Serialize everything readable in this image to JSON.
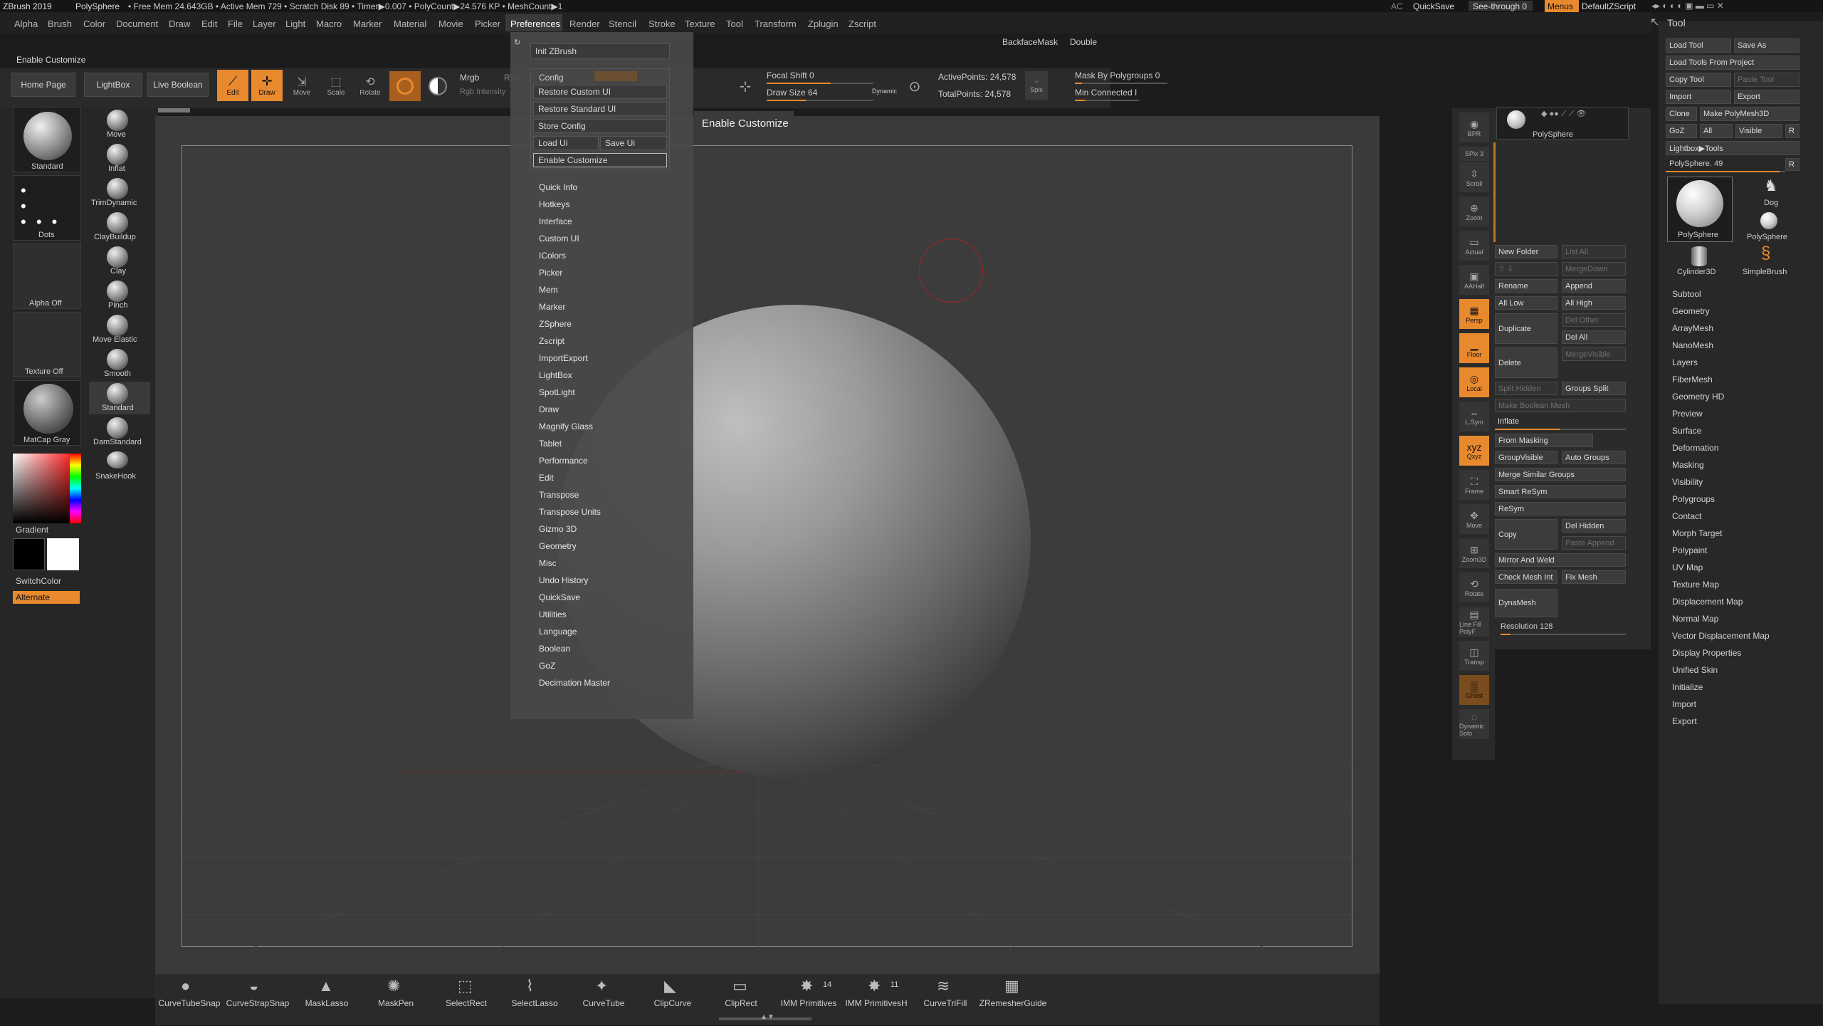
{
  "topbar": {
    "app": "ZBrush 2019",
    "project": "PolySphere",
    "status": "• Free Mem 24.643GB • Active Mem 729 • Scratch Disk 89 • Timer▶0.007 • PolyCount▶24.576 KP • MeshCount▶1",
    "ac": "AC",
    "quicksave": "QuickSave",
    "seethrough": "See-through  0",
    "menus": "Menus",
    "zscript": "DefaultZScript"
  },
  "menubar": [
    "Alpha",
    "Brush",
    "Color",
    "Document",
    "Draw",
    "Edit",
    "File",
    "Layer",
    "Light",
    "Macro",
    "Marker",
    "Material",
    "Movie",
    "Picker",
    "Preferences",
    "Render",
    "Stencil",
    "Stroke",
    "Texture",
    "Tool",
    "Transform",
    "Zplugin",
    "Zscript"
  ],
  "enable_customize_label": "Enable Customize",
  "shelf": {
    "home": "Home Page",
    "lightbox": "LightBox",
    "liveboolean": "Live Boolean",
    "edit": "Edit",
    "draw": "Draw",
    "move": "Move",
    "scale": "Scale",
    "rotate": "Rotate",
    "mrgb": "Mrgb",
    "rgb": "Rgb",
    "rgbint": "Rgb Intensity",
    "focal": "Focal Shift 0",
    "drawsize": "Draw Size 64",
    "dynamic": "Dynamic",
    "active": "ActivePoints: 24,578",
    "total": "TotalPoints: 24,578",
    "spix": "Spix",
    "mask": "Mask By Polygroups 0",
    "minconn": "Min Connected I",
    "backface": "BackfaceMask",
    "double": "Double"
  },
  "left": {
    "brushes": [
      "Standard",
      "Dots",
      "Alpha Off",
      "Texture Off",
      "MatCap Gray"
    ],
    "tools": [
      "Move",
      "Inflat",
      "TrimDynamic",
      "ClayBuildup",
      "Clay",
      "Pinch",
      "Move Elastic",
      "Smooth",
      "Standard",
      "DamStandard",
      "SnakeHook"
    ],
    "gradient": "Gradient",
    "switchcolor": "SwitchColor",
    "alternate": "Alternate"
  },
  "prefs": {
    "init": "Init ZBrush",
    "config": "Config",
    "restore_custom": "Restore Custom UI",
    "restore_std": "Restore Standard UI",
    "store": "Store Config",
    "loadui": "Load Ui",
    "saveui": "Save Ui",
    "enable": "Enable Customize",
    "tooltip": "Enable Customize",
    "items": [
      "Quick Info",
      "Hotkeys",
      "Interface",
      "Custom UI",
      "IColors",
      "Picker",
      "Mem",
      "Marker",
      "ZSphere",
      "Zscript",
      "ImportExport",
      "LightBox",
      "SpotLight",
      "Draw",
      "Magnify Glass",
      "Tablet",
      "Performance",
      "Edit",
      "Transpose",
      "Transpose Units",
      "Gizmo 3D",
      "Geometry",
      "Misc",
      "Undo History",
      "QuickSave",
      "Utilities",
      "Language",
      "Boolean",
      "GoZ",
      "Decimation Master"
    ]
  },
  "rightshelf": [
    "BPR",
    "SPix 3",
    "Scroll",
    "Zoom",
    "Actual",
    "AAHalf",
    "Persp",
    "Floor",
    "Local",
    "L.Sym",
    "Qxyz",
    "Frame",
    "Move",
    "Zoom3D",
    "Rotate",
    "Line Fill PolyF",
    "Transp",
    "Ghost",
    "Dynamic Solo"
  ],
  "subtool": {
    "name": "PolySphere",
    "newfolder": "New Folder",
    "listall": "List All",
    "mergedown": "MergeDown",
    "rename": "Rename",
    "append": "Append",
    "alllow": "All Low",
    "allhigh": "All High",
    "delother": "Del Other",
    "duplicate": "Duplicate",
    "delall": "Del All",
    "mergevisible": "MergeVisible",
    "delete": "Delete",
    "splithidden": "Split Hidden",
    "groupssplit": "Groups Split",
    "makebool": "Make Boolean Mesh",
    "inflate": "Inflate",
    "frommasking": "From Masking",
    "groupvisible": "GroupVisible",
    "autogroups": "Auto Groups",
    "mergesimilar": "Merge Similar Groups",
    "smartresym": "Smart ReSym",
    "resym": "ReSym",
    "copy": "Copy",
    "delhidden": "Del Hidden",
    "pasteappend": "Paste Append",
    "mirrorweld": "Mirror And Weld",
    "checkmesh": "Check Mesh Int",
    "fixmesh": "Fix Mesh",
    "dynamesh": "DynaMesh",
    "resolution": "Resolution 128"
  },
  "tool": {
    "title": "Tool",
    "load": "Load Tool",
    "saveas": "Save As",
    "loadproj": "Load Tools From Project",
    "copytool": "Copy Tool",
    "pastetool": "Paste Tool",
    "import": "Import",
    "export": "Export",
    "clone": "Clone",
    "makepoly": "Make PolyMesh3D",
    "goz": "GoZ",
    "all": "All",
    "visible": "Visible",
    "r": "R",
    "lightbox": "Lightbox▶Tools",
    "polysphere": "PolySphere. 49",
    "thumbs": [
      "PolySphere",
      "Dog",
      "PolySphere",
      "Cylinder3D",
      "SimpleBrush"
    ],
    "sections": [
      "Subtool",
      "Geometry",
      "ArrayMesh",
      "NanoMesh",
      "Layers",
      "FiberMesh",
      "Geometry HD",
      "Preview",
      "Surface",
      "Deformation",
      "Masking",
      "Visibility",
      "Polygroups",
      "Contact",
      "Morph Target",
      "Polypaint",
      "UV Map",
      "Texture Map",
      "Displacement Map",
      "Normal Map",
      "Vector Displacement Map",
      "Display Properties",
      "Unified Skin",
      "Initialize",
      "Import",
      "Export"
    ]
  },
  "bottom": [
    "CurveTubeSnap",
    "CurveStrapSnap",
    "MaskLasso",
    "MaskPen",
    "SelectRect",
    "SelectLasso",
    "CurveTube",
    "ClipCurve",
    "ClipRect",
    "IMM Primitives",
    "IMM PrimitivesH",
    "CurveTriFill",
    "ZRemesherGuide"
  ],
  "imm_counts": [
    "14",
    "11"
  ]
}
